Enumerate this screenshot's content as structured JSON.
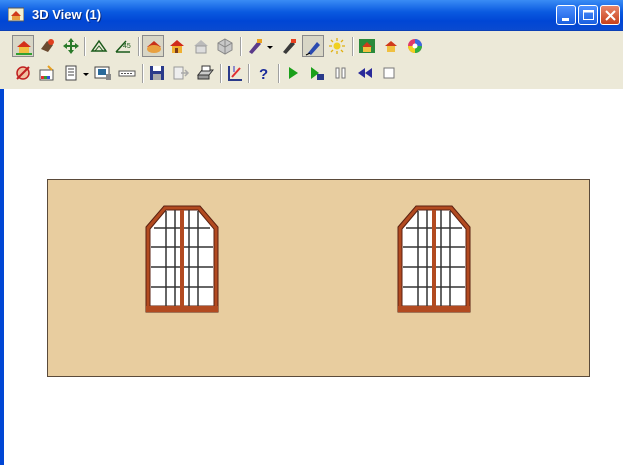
{
  "window": {
    "title": "3D View (1)"
  },
  "toolbar": {
    "row1": [
      {
        "icon": "house-view-icon",
        "pressed": true
      },
      {
        "icon": "camera-icon"
      },
      {
        "icon": "move-arrows-icon"
      },
      {
        "icon": "perspective-icon"
      },
      {
        "icon": "angle-45-icon"
      },
      {
        "icon": "render-solid-icon",
        "pressed": true
      },
      {
        "icon": "render-house-icon"
      },
      {
        "icon": "render-wire-icon"
      },
      {
        "icon": "render-hidden-icon"
      },
      {
        "icon": "pen-color-icon"
      },
      {
        "icon": "pen-dropdown-icon"
      },
      {
        "icon": "pen-paint-icon"
      },
      {
        "icon": "pen-active-icon",
        "pressed": true
      },
      {
        "icon": "sun-light-icon"
      },
      {
        "icon": "picture-icon"
      },
      {
        "icon": "small-house-icon"
      },
      {
        "icon": "color-wheel-icon"
      }
    ],
    "row2": [
      {
        "icon": "no-texture-icon"
      },
      {
        "icon": "material-palette-icon"
      },
      {
        "icon": "layer-icon"
      },
      {
        "icon": "dropdown-arrow-icon"
      },
      {
        "icon": "display-icon"
      },
      {
        "icon": "dash-line-icon"
      },
      {
        "icon": "save-disk-icon"
      },
      {
        "icon": "export-icon"
      },
      {
        "icon": "print-icon"
      },
      {
        "icon": "measure-icon"
      },
      {
        "icon": "help-icon"
      },
      {
        "icon": "play-icon"
      },
      {
        "icon": "play-record-icon"
      },
      {
        "icon": "pause-icon"
      },
      {
        "icon": "rewind-icon"
      },
      {
        "icon": "stop-icon"
      }
    ]
  },
  "colors": {
    "wall": "#e8cd9f",
    "frame": "#b24a20",
    "accent": "#0046d5"
  }
}
